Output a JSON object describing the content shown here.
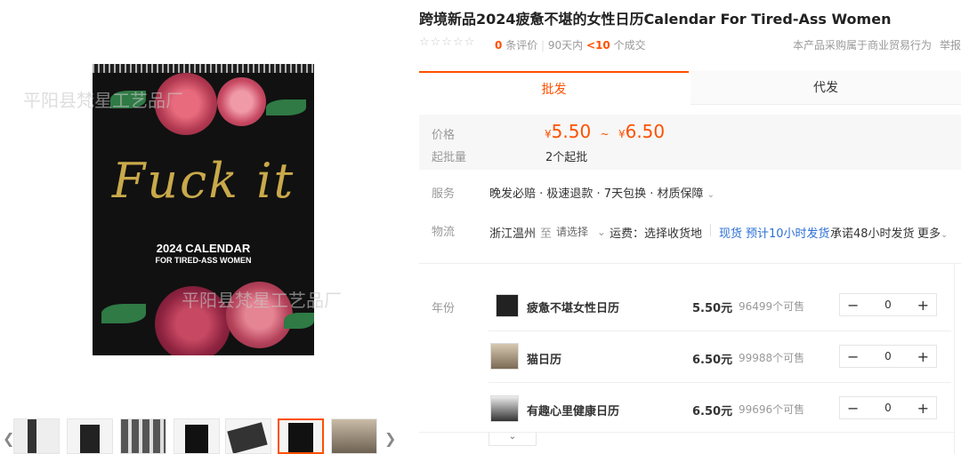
{
  "gallery": {
    "watermark": "平阳县梵星工艺品厂",
    "calendar_script": "Fuck it",
    "calendar_year": "2024 CALENDAR",
    "calendar_sub": "FOR TIRED-ASS WOMEN",
    "thumb_count": 7,
    "prev_icon": "chevron-left-icon",
    "next_icon": "chevron-right-icon"
  },
  "product": {
    "title": "跨境新品2024疲惫不堪的女性日历Calendar For Tired-Ass Women",
    "stars": "☆☆☆☆☆",
    "review_count": "0",
    "review_label": "条评价",
    "sales_period": "90天内",
    "sales_count": "<10",
    "sales_unit": "个成交",
    "trade_note": "本产品采购属于商业贸易行为",
    "report": "举报"
  },
  "tabs": [
    "批发",
    "代发"
  ],
  "pricing": {
    "price_label": "价格",
    "currency": "¥",
    "price_min": "5.50",
    "price_sep": "~",
    "price_max": "6.50",
    "moq_label": "起批量",
    "moq_value": "2个起批"
  },
  "service": {
    "label": "服务",
    "value": "晚发必赔 · 极速退款 · 7天包换 · 材质保障"
  },
  "logistics": {
    "label": "物流",
    "origin": "浙江温州",
    "to": "至",
    "select": "请选择",
    "fee": "运费：选择收货地",
    "stock_tag": "现货",
    "eta": "预计10小时发货",
    "promise": "承诺48小时发货",
    "more": "更多"
  },
  "variants": {
    "label": "年份",
    "items": [
      {
        "name": "疲惫不堪女性日历",
        "price": "5.50元",
        "stock": "96499个可售",
        "qty": "0"
      },
      {
        "name": "猫日历",
        "price": "6.50元",
        "stock": "99988个可售",
        "qty": "0"
      },
      {
        "name": "有趣心里健康日历",
        "price": "6.50元",
        "stock": "99696个可售",
        "qty": "0"
      }
    ],
    "minus": "−",
    "plus": "+",
    "expand_icon": "chevron-down-icon"
  },
  "colors": {
    "accent": "#ff5000",
    "link": "#2b6fd6"
  }
}
